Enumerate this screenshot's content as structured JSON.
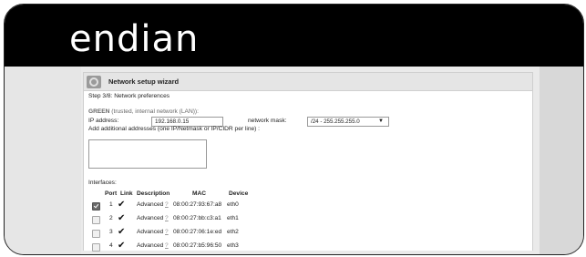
{
  "brand": {
    "logo_text": "endian"
  },
  "wizard": {
    "title": "Network setup wizard",
    "step": "Step 3/8: Network preferences"
  },
  "green": {
    "label_bold": "GREEN",
    "label_rest": " (trusted, internal network (LAN)):",
    "ip_label": "IP address:",
    "ip_value": "192.168.0.15",
    "mask_label": "network mask:",
    "mask_value": "/24 - 255.255.255.0",
    "additional_label": "Add additional addresses (one IP/Netmask or IP/CIDR per line) :",
    "additional_value": ""
  },
  "interfaces": {
    "label": "Interfaces:",
    "columns": {
      "port": "Port",
      "link": "Link",
      "description": "Description",
      "mac": "MAC",
      "device": "Device"
    },
    "rows": [
      {
        "selected": true,
        "port": "1",
        "link": "✔",
        "description": "Advanced",
        "help": "?",
        "mac": "08:00:27:93:67:a8",
        "device": "eth0"
      },
      {
        "selected": false,
        "port": "2",
        "link": "✔",
        "description": "Advanced",
        "help": "?",
        "mac": "08:00:27:bb:c3:a1",
        "device": "eth1"
      },
      {
        "selected": false,
        "port": "3",
        "link": "✔",
        "description": "Advanced",
        "help": "?",
        "mac": "08:00:27:06:1e:ed",
        "device": "eth2"
      },
      {
        "selected": false,
        "port": "4",
        "link": "✔",
        "description": "Advanced",
        "help": "?",
        "mac": "08:00:27:b5:96:50",
        "device": "eth3"
      }
    ]
  },
  "colors": {
    "header_bg": "#000000",
    "logo": "#ffffff",
    "checked_box": "#6a6a6a"
  }
}
